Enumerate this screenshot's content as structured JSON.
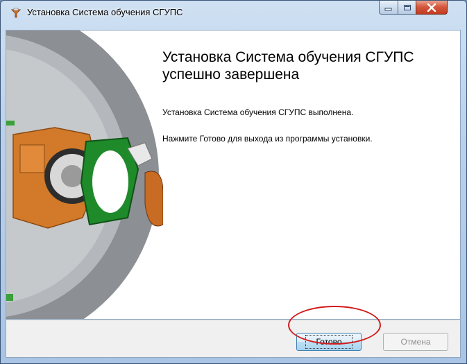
{
  "window": {
    "title": "Установка Система обучения СГУПС"
  },
  "main": {
    "heading": "Установка Система обучения СГУПС успешно завершена",
    "text_completed": "Установка Система обучения СГУПС выполнена.",
    "text_instruction": "Нажмите Готово для выхода из программы установки."
  },
  "footer": {
    "finish_label": "Готово",
    "cancel_label": "Отмена"
  },
  "colors": {
    "highlight": "#d21a1a"
  }
}
